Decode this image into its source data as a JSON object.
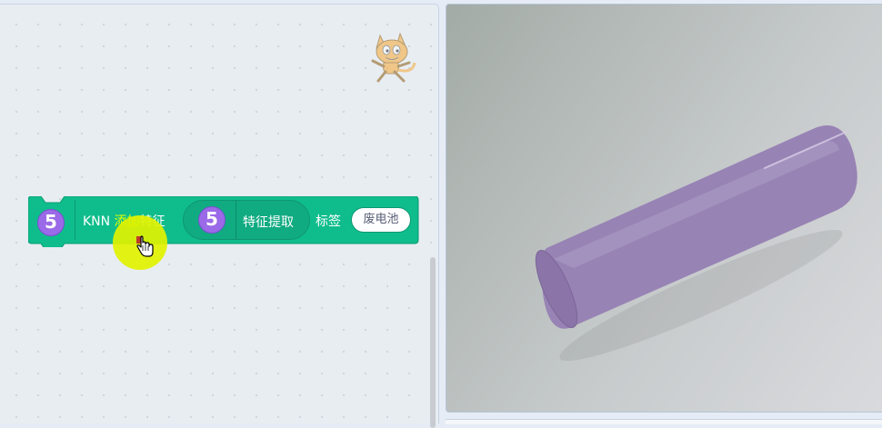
{
  "block": {
    "ext_number": "5",
    "text_prefix": "KNN ",
    "text_highlight": "添加",
    "text_suffix": "特征",
    "reporter_number": "5",
    "reporter_label": "特征提取",
    "label_word": "标签",
    "label_value": "废电池"
  },
  "colors": {
    "block": "#0fbd8c",
    "extension_icon": "#9966ff",
    "highlight": "#e1f200"
  },
  "icons": {
    "sprite": "scratch-cat-icon",
    "cursor": "hand-pointer-icon"
  }
}
